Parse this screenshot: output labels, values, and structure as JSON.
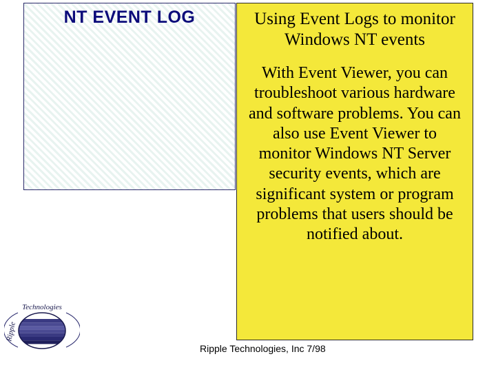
{
  "left": {
    "title": "NT EVENT LOG"
  },
  "right": {
    "subtitle": "Using Event Logs to monitor Windows NT events",
    "body": "With Event Viewer, you can troubleshoot various hardware and software problems. You can also use Event Viewer to monitor Windows NT Server security events, which are significant system or program problems that users should be notified about."
  },
  "footer": "Ripple Technologies, Inc 7/98",
  "logo": {
    "name": "ripple-technologies-logo"
  }
}
